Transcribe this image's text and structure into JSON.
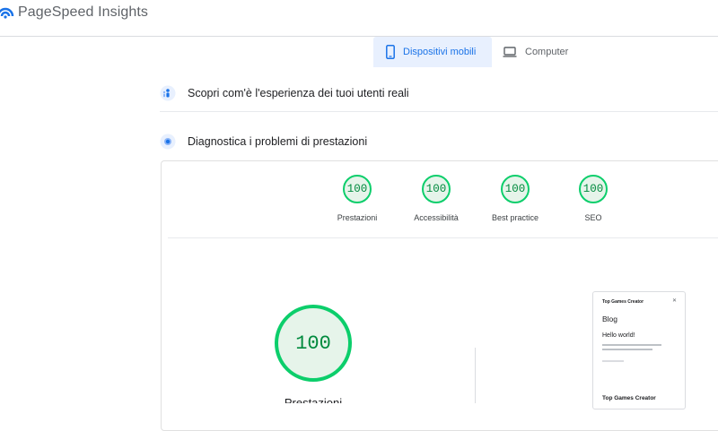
{
  "header": {
    "app_title": "PageSpeed Insights",
    "logo_icon": "pagespeed-logo-icon"
  },
  "tabs": [
    {
      "label": "Dispositivi mobili",
      "icon": "smartphone-icon",
      "active": true
    },
    {
      "label": "Computer",
      "icon": "laptop-icon",
      "active": false
    }
  ],
  "sections": {
    "field_data": {
      "title": "Scopri com'è l'esperienza dei tuoi utenti reali",
      "icon": "users-field-data-icon"
    },
    "diagnostics": {
      "title": "Diagnostica i problemi di prestazioni",
      "icon": "lab-data-icon"
    }
  },
  "scores": [
    {
      "label": "Prestazioni",
      "value": "100"
    },
    {
      "label": "Accessibilità",
      "value": "100"
    },
    {
      "label": "Best practice",
      "value": "100"
    },
    {
      "label": "SEO",
      "value": "100"
    }
  ],
  "main_score": {
    "value": "100",
    "label": "Prestazioni"
  },
  "preview": {
    "site_name": "Top Games Creator",
    "heading": "Blog",
    "post_title": "Hello world!",
    "footer_title": "Top Games Creator"
  },
  "colors": {
    "pass_green": "#0cce6b",
    "pass_text": "#008a3e",
    "pass_bg": "#e6f4ea",
    "accent_blue": "#1a73e8",
    "active_tab_bg": "#e8f0fe"
  }
}
